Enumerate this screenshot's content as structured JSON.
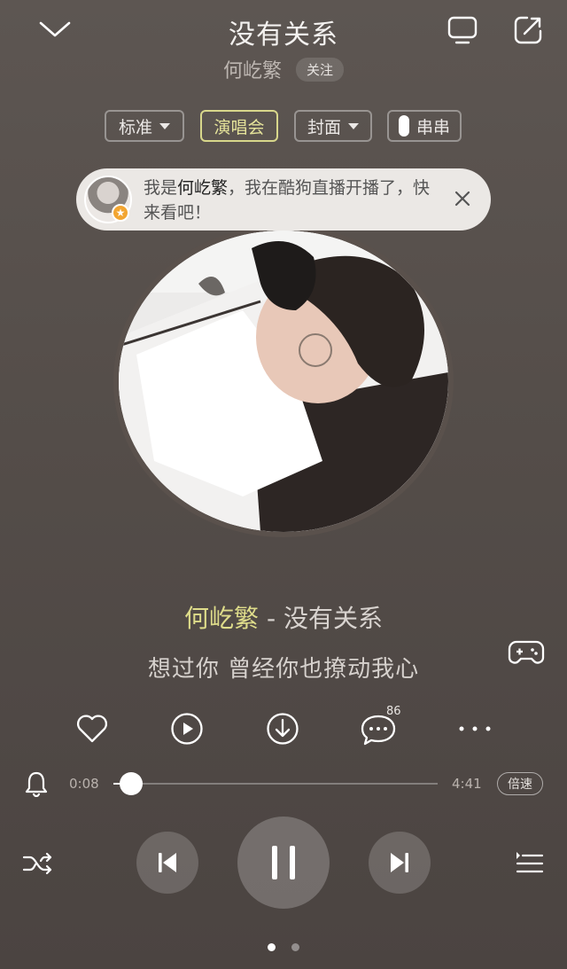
{
  "header": {
    "title": "没有关系",
    "artist": "何屹繁",
    "follow_label": "关注"
  },
  "options": {
    "quality_label": "标准",
    "concert_label": "演唱会",
    "cover_label": "封面",
    "chuanchuan_label": "串串"
  },
  "live_banner": {
    "text_before": "我是",
    "name": "何屹繁",
    "text_after": "，我在酷狗直播开播了，快来看吧！",
    "badge_icon": "star-icon"
  },
  "song": {
    "artist": "何屹繁",
    "separator": " - ",
    "title": "没有关系",
    "lyric": "想过你 曾经你也撩动我心"
  },
  "actions": {
    "comment_count": "86"
  },
  "progress": {
    "current_time": "0:08",
    "total_time": "4:41",
    "fraction": 0.028,
    "speed_label": "倍速"
  },
  "pager": {
    "pages": 2,
    "active_index": 0
  },
  "colors": {
    "accent_yellow": "#dedc8a",
    "background": "#544d49"
  }
}
